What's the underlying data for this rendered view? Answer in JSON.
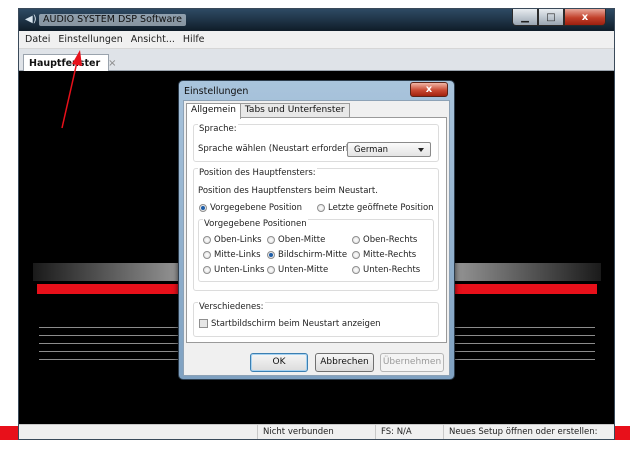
{
  "window": {
    "title": "AUDIO SYSTEM DSP Software",
    "controls": {
      "minimize": "▁",
      "maximize": "□",
      "close": "x"
    }
  },
  "menu": {
    "items": [
      "Datei",
      "Einstellungen",
      "Ansicht...",
      "Hilfe"
    ]
  },
  "document_tab": {
    "label": "Hauptfenster",
    "close": "×"
  },
  "statusbar": {
    "connection": "Nicht verbunden",
    "fs": "FS: N/A",
    "hint": "Neues Setup öffnen oder erstellen:"
  },
  "dialog": {
    "title": "Einstellungen",
    "close_label": "x",
    "tabs": [
      "Allgemein",
      "Tabs und Unterfenster"
    ],
    "active_tab": "Allgemein",
    "language": {
      "group_title": "Sprache:",
      "label": "Sprache wählen (Neustart erforderlich):",
      "selected": "German"
    },
    "position": {
      "group_title": "Position des Hauptfensters:",
      "description": "Position des Hauptfensters beim Neustart.",
      "mode_default": "Vorgegebene Position",
      "mode_last": "Letzte geöffnete Position",
      "mode_selected": "Vorgegebene Position",
      "presets_title": "Vorgegebene Positionen",
      "presets": {
        "top_left": "Oben-Links",
        "top_center": "Oben-Mitte",
        "top_right": "Oben-Rechts",
        "middle_left": "Mitte-Links",
        "center": "Bildschirm-Mitte",
        "middle_right": "Mitte-Rechts",
        "bottom_left": "Unten-Links",
        "bottom_center": "Unten-Mitte",
        "bottom_right": "Unten-Rechts"
      },
      "preset_selected": "Bildschirm-Mitte"
    },
    "misc": {
      "group_title": "Verschiedenes:",
      "startup_screen": "Startbildschirm beim Neustart anzeigen",
      "startup_screen_checked": false
    },
    "buttons": {
      "ok": "OK",
      "cancel": "Abbrechen",
      "apply": "Übernehmen"
    }
  },
  "colors": {
    "accent_red": "#e8101a",
    "annotation_arrow": "#e8101a",
    "radio_selected": "#1f5ea8"
  }
}
